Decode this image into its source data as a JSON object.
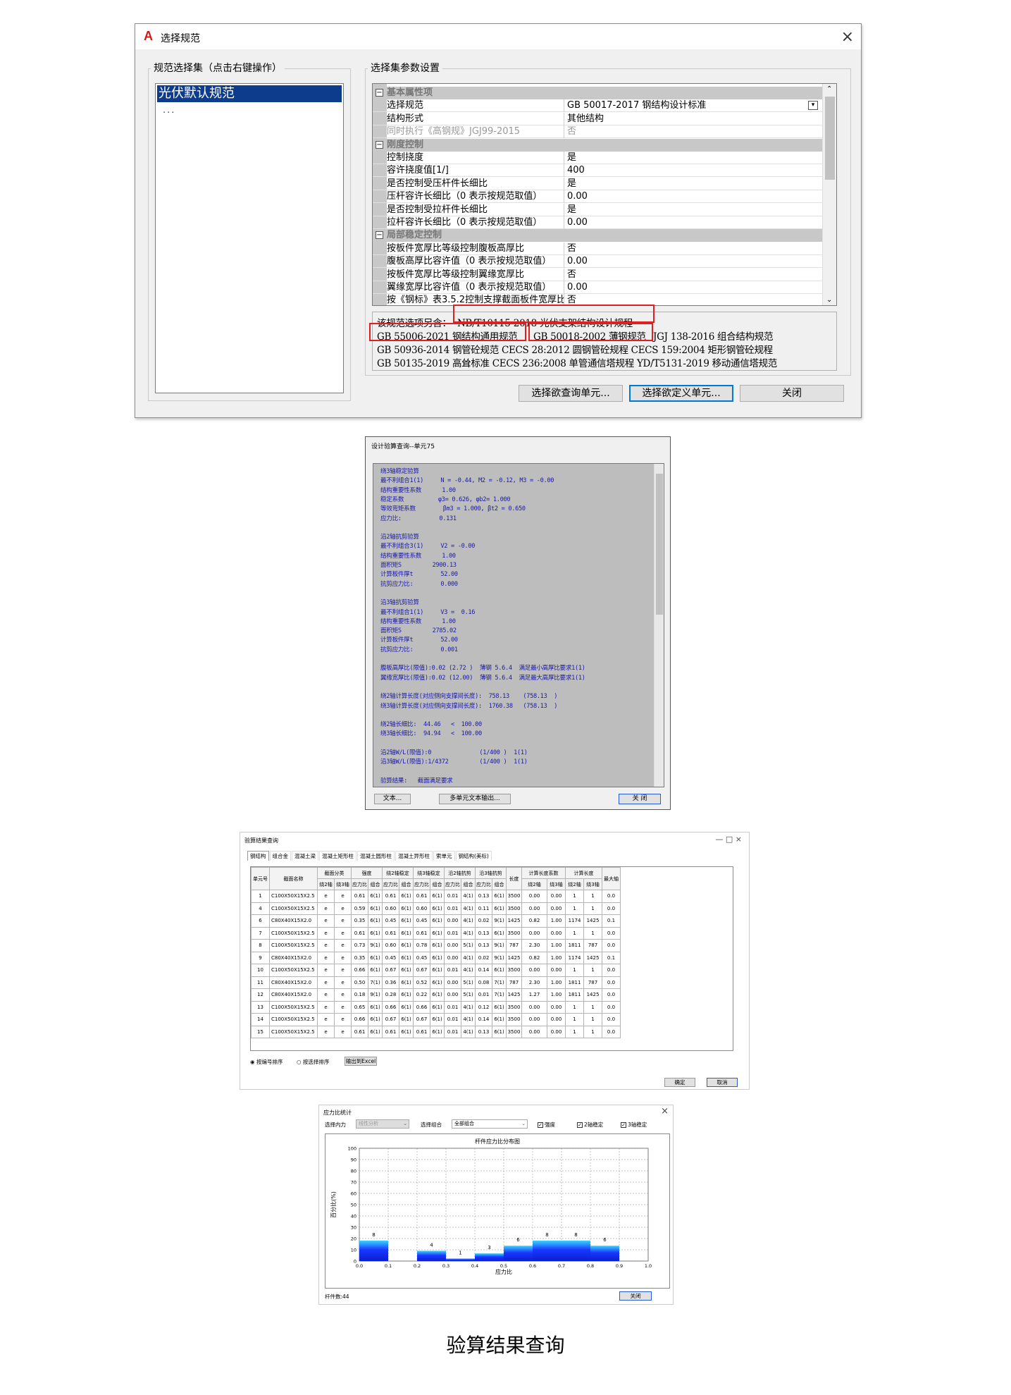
{
  "dialog1": {
    "logo": "A",
    "title": "选择规范",
    "close_glyph": "×",
    "left_group_label": "规范选择集（点击右键操作）",
    "list_selected": "光伏默认规范",
    "list_more": "...",
    "right_group_label": "选择集参数设置",
    "properties": [
      {
        "type": "cat",
        "label": "基本属性项"
      },
      {
        "key": "选择规范",
        "value": "GB 50017-2017      钢结构设计标准",
        "combo": true
      },
      {
        "key": "结构形式",
        "value": "其他结构"
      },
      {
        "key": "同时执行《高钢规》JGJ99-2015",
        "value": "否",
        "disabled": true
      },
      {
        "type": "cat",
        "label": "刚度控制"
      },
      {
        "key": "控制挠度",
        "value": "是"
      },
      {
        "key": "容许挠度值[1/]",
        "value": "400"
      },
      {
        "key": "是否控制受压杆件长细比",
        "value": "是"
      },
      {
        "key": "压杆容许长细比（0 表示按规范取值）",
        "value": "0.00"
      },
      {
        "key": "是否控制受拉杆件长细比",
        "value": "是"
      },
      {
        "key": "拉杆容许长细比（0 表示按规范取值）",
        "value": "0.00"
      },
      {
        "type": "cat",
        "label": "局部稳定控制"
      },
      {
        "key": "按板件宽厚比等级控制腹板高厚比",
        "value": "否"
      },
      {
        "key": "腹板高厚比容许值（0 表示按规范取值）",
        "value": "0.00"
      },
      {
        "key": "按板件宽厚比等级控制翼缘宽厚比",
        "value": "否"
      },
      {
        "key": "翼缘宽厚比容许值（0 表示按规范取值）",
        "value": "0.00"
      },
      {
        "key": "按《钢标》表3.5.2控制支撑截面板件宽厚比",
        "value": "否"
      }
    ],
    "standards": {
      "line1_prefix": "该规范选项另含：",
      "line1_item": "NB/T10115-2018 光伏支架结构设计规程",
      "line2": [
        "GB 55006-2021 钢结构通用规范",
        "GB 50018-2002 薄钢规范",
        "JGJ 138-2016 组合结构规范"
      ],
      "line3": "GB 50936-2014 钢管砼规范  CECS 28:2012 圆钢管砼规程  CECS 159:2004 矩形钢管砼规程",
      "line4": "GB 50135-2019 高耸标准  CECS 236:2008 单管通信塔规程  YD/T5131-2019 移动通信塔规范"
    },
    "buttons": {
      "query": "选择欲查询单元...",
      "custom": "选择欲定义单元...",
      "close": "关闭"
    }
  },
  "dialog2": {
    "title": "设计验算查询--单元75",
    "lines": [
      "绕3轴稳定验算",
      "最不利组合1(1)     N = -0.44, M2 = -0.12, M3 = -0.00",
      "结构重要性系数      1.00",
      "稳定系数          φ3= 0.626, φb2= 1.000",
      "等效弯矩系数        βm3 = 1.000, βt2 = 0.650",
      "应力比:           0.131",
      "",
      "沿2轴抗剪验算",
      "最不利组合3(1)     V2 = -0.00",
      "结构重要性系数      1.00",
      "面积矩S         2900.13",
      "计算板件厚t        52.00",
      "抗剪应力比:        0.000",
      "",
      "沿3轴抗剪验算",
      "最不利组合1(1)     V3 =  0.16",
      "结构重要性系数      1.00",
      "面积矩S         2785.02",
      "计算板件厚t        52.00",
      "抗剪应力比:        0.001",
      "",
      "腹板高厚比(限值):0.02 (2.72 )  薄钢 5.6.4  满足最小高厚比要求1(1)",
      "翼缘宽厚比(限值):0.02 (12.00)  薄钢 5.6.4  满足最大高厚比要求1(1)",
      "",
      "绕2轴计算长度(对应侧向支撑间长度):  758.13    (758.13  )",
      "绕3轴计算长度(对应侧向支撑间长度):  1760.38   (758.13  )",
      "",
      "绕2轴长细比:  44.46   <  100.00",
      "绕3轴长细比:  94.94   <  100.00",
      "",
      "沿2轴W/L(限值):0              (1/400 )  1(1)",
      "沿3轴W/L(限值):1/4372         (1/400 )  1(1)",
      "",
      "验算结果:   截面满足要求"
    ],
    "buttons": {
      "text": "文本...",
      "multi": "多单元文本输出...",
      "close": "关  闭"
    }
  },
  "dialog3": {
    "title": "验算结果查询",
    "win_buttons": "—    □    ×",
    "tabs": [
      "钢结构",
      "组合金",
      "混凝土梁",
      "混凝土矩形柱",
      "混凝土圆形柱",
      "混凝土异形柱",
      "索单元",
      "钢结构(美标)"
    ],
    "group_headers": [
      "单元号",
      "截面名称",
      "截面分类",
      "强度",
      "绕2轴稳定",
      "绕3轴稳定",
      "沿2轴抗剪",
      "沿3轴抗剪",
      "长度",
      "计算长度系数",
      "计算长度",
      "最大轴"
    ],
    "sub_headers": [
      "绕2轴",
      "绕3轴",
      "应力比",
      "组合",
      "应力比",
      "组合",
      "应力比",
      "组合",
      "应力比",
      "组合",
      "应力比",
      "组合",
      "绕2轴",
      "绕3轴",
      "绕2轴",
      "绕3轴"
    ],
    "rows": [
      [
        "1",
        "C100X50X15X2.5",
        "e",
        "e",
        "0.61",
        "6(1)",
        "0.61",
        "6(1)",
        "0.61",
        "6(1)",
        "0.01",
        "4(1)",
        "0.13",
        "6(1)",
        "3500",
        "0.00",
        "0.00",
        "1",
        "1",
        "0.0"
      ],
      [
        "4",
        "C100X50X15X2.5",
        "e",
        "e",
        "0.59",
        "6(1)",
        "0.60",
        "6(1)",
        "0.60",
        "6(1)",
        "0.01",
        "4(1)",
        "0.11",
        "6(1)",
        "3500",
        "0.00",
        "0.00",
        "1",
        "1",
        "0.0"
      ],
      [
        "6",
        "C80X40X15X2.0",
        "e",
        "e",
        "0.35",
        "6(1)",
        "0.45",
        "6(1)",
        "0.45",
        "6(1)",
        "0.00",
        "4(1)",
        "0.02",
        "9(1)",
        "1425",
        "0.82",
        "1.00",
        "1174",
        "1425",
        "0.1"
      ],
      [
        "7",
        "C100X50X15X2.5",
        "e",
        "e",
        "0.61",
        "6(1)",
        "0.61",
        "6(1)",
        "0.61",
        "6(1)",
        "0.01",
        "4(1)",
        "0.13",
        "6(1)",
        "3500",
        "0.00",
        "0.00",
        "1",
        "1",
        "0.0"
      ],
      [
        "8",
        "C100X50X15X2.5",
        "e",
        "e",
        "0.73",
        "9(1)",
        "0.60",
        "6(1)",
        "0.78",
        "6(1)",
        "0.00",
        "5(1)",
        "0.13",
        "9(1)",
        "787",
        "2.30",
        "1.00",
        "1811",
        "787",
        "0.0"
      ],
      [
        "9",
        "C80X40X15X2.0",
        "e",
        "e",
        "0.35",
        "6(1)",
        "0.45",
        "6(1)",
        "0.45",
        "6(1)",
        "0.00",
        "4(1)",
        "0.02",
        "9(1)",
        "1425",
        "0.82",
        "1.00",
        "1174",
        "1425",
        "0.1"
      ],
      [
        "10",
        "C100X50X15X2.5",
        "e",
        "e",
        "0.66",
        "6(1)",
        "0.67",
        "6(1)",
        "0.67",
        "6(1)",
        "0.01",
        "4(1)",
        "0.14",
        "6(1)",
        "3500",
        "0.00",
        "0.00",
        "1",
        "1",
        "0.0"
      ],
      [
        "11",
        "C80X40X15X2.0",
        "e",
        "e",
        "0.50",
        "7(1)",
        "0.36",
        "6(1)",
        "0.52",
        "6(1)",
        "0.00",
        "5(1)",
        "0.08",
        "7(1)",
        "787",
        "2.30",
        "1.00",
        "1811",
        "787",
        "0.0"
      ],
      [
        "12",
        "C80X40X15X2.0",
        "e",
        "e",
        "0.18",
        "9(1)",
        "0.28",
        "6(1)",
        "0.22",
        "6(1)",
        "0.00",
        "5(1)",
        "0.01",
        "7(1)",
        "1425",
        "1.27",
        "1.00",
        "1811",
        "1425",
        "0.0"
      ],
      [
        "13",
        "C100X50X15X2.5",
        "e",
        "e",
        "0.65",
        "6(1)",
        "0.66",
        "6(1)",
        "0.66",
        "6(1)",
        "0.01",
        "4(1)",
        "0.12",
        "6(1)",
        "3500",
        "0.00",
        "0.00",
        "1",
        "1",
        "0.0"
      ],
      [
        "14",
        "C100X50X15X2.5",
        "e",
        "e",
        "0.66",
        "6(1)",
        "0.67",
        "6(1)",
        "0.67",
        "6(1)",
        "0.01",
        "4(1)",
        "0.14",
        "6(1)",
        "3500",
        "0.00",
        "0.00",
        "1",
        "1",
        "0.0"
      ],
      [
        "15",
        "C100X50X15X2.5",
        "e",
        "e",
        "0.61",
        "6(1)",
        "0.61",
        "6(1)",
        "0.61",
        "6(1)",
        "0.01",
        "4(1)",
        "0.13",
        "6(1)",
        "3500",
        "0.00",
        "0.00",
        "1",
        "1",
        "0.0"
      ]
    ],
    "radio_by_number": "按编号排序",
    "radio_by_selection": "按选择排序",
    "export_button": "输出到Excel",
    "ok_button": "确定",
    "cancel_button": "取消"
  },
  "dialog4": {
    "title": "应力比统计",
    "close_glyph": "×",
    "force_label": "选择内力",
    "force_value": "线性分析",
    "combo_label": "选择组合",
    "combo_value": "全部组合",
    "check_strength": "强度",
    "check_2axis": "2轴稳定",
    "check_3axis": "3轴稳定",
    "count_label": "杆件数:44",
    "close_button": "关闭"
  },
  "chart_data": {
    "type": "bar",
    "title": "杆件应力比分布图",
    "xlabel": "应力比",
    "ylabel": "百分比(%)",
    "bins": [
      [
        0.0,
        0.1
      ],
      [
        0.1,
        0.2
      ],
      [
        0.2,
        0.3
      ],
      [
        0.3,
        0.4
      ],
      [
        0.4,
        0.5
      ],
      [
        0.5,
        0.6
      ],
      [
        0.6,
        0.7
      ],
      [
        0.7,
        0.8
      ],
      [
        0.8,
        0.9
      ],
      [
        0.9,
        1.0
      ]
    ],
    "values": [
      18.2,
      0,
      9.1,
      2.3,
      6.8,
      13.6,
      18.2,
      18.2,
      13.6,
      0
    ],
    "counts": [
      "8",
      "",
      "4",
      "1",
      "3",
      "6",
      "8",
      "8",
      "6",
      ""
    ],
    "xlim": [
      0,
      1.0
    ],
    "ylim": [
      0,
      100
    ],
    "xticks": [
      "0.0",
      "0.1",
      "0.2",
      "0.3",
      "0.4",
      "0.5",
      "0.6",
      "0.7",
      "0.8",
      "0.9",
      "1.0"
    ],
    "yticks": [
      "0",
      "10",
      "20",
      "30",
      "40",
      "50",
      "60",
      "70",
      "80",
      "90",
      "100"
    ],
    "grid": true,
    "bar_color": "#1a37ff"
  },
  "caption": "验算结果查询"
}
